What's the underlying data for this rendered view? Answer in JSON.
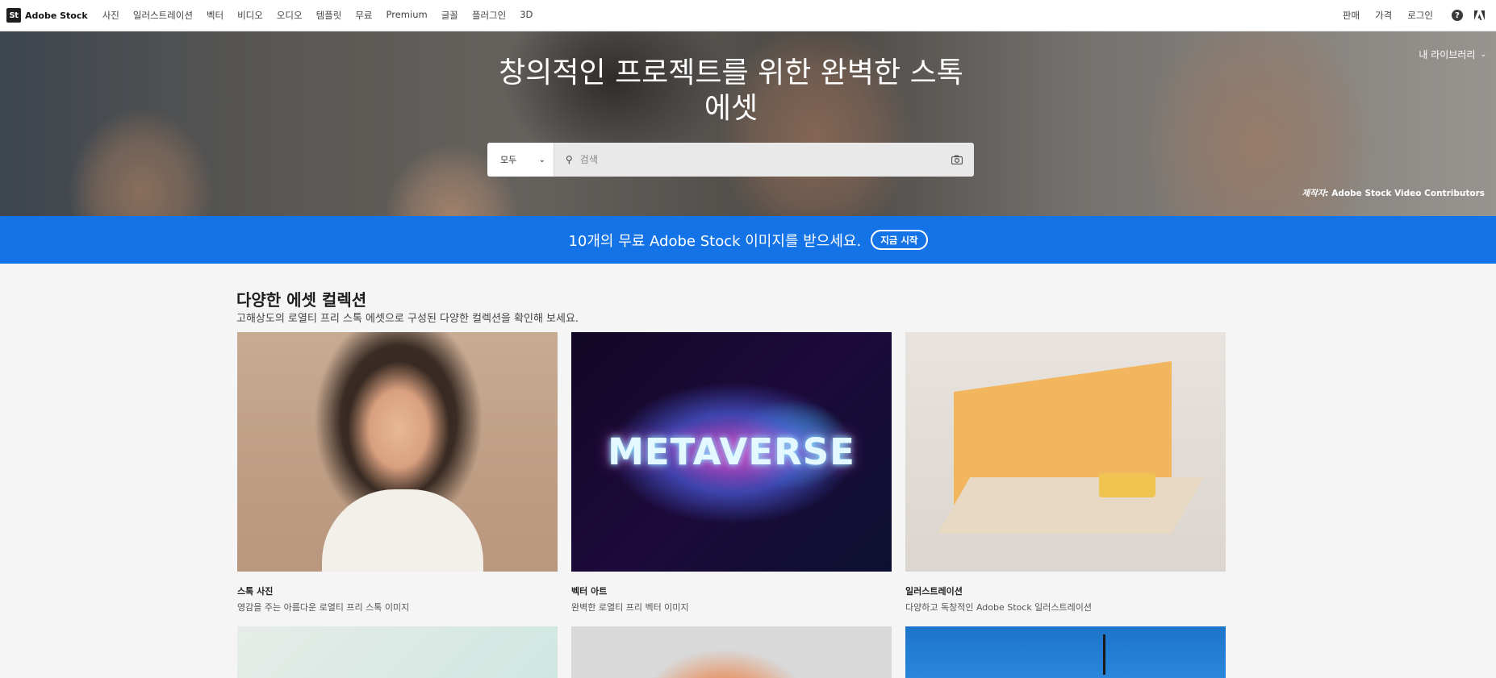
{
  "brand": {
    "logo": "St",
    "name": "Adobe Stock"
  },
  "nav": {
    "links": [
      "사진",
      "일러스트레이션",
      "벡터",
      "비디오",
      "오디오",
      "템플릿",
      "무료",
      "Premium",
      "글꼴",
      "플러그인",
      "3D"
    ],
    "right": [
      "판매",
      "가격",
      "로그인"
    ],
    "help_icon": "help-circle-icon",
    "adobe_icon": "adobe-logo-icon"
  },
  "hero": {
    "title": "창의적인 프로젝트를 위한 완벽한 스톡 에셋",
    "my_library": "내 라이브러리",
    "credit_prefix": "제작자:",
    "credit_name": "Adobe Stock Video Contributors",
    "search": {
      "filter": "모두",
      "placeholder": "검색"
    }
  },
  "promo": {
    "text": "10개의 무료 Adobe Stock 이미지를 받으세요.",
    "button": "지금 시작"
  },
  "collections": {
    "title": "다양한 에셋 컬렉션",
    "subtitle": "고해상도의 로열티 프리 스톡 에셋으로 구성된 다양한 컬렉션을 확인해 보세요.",
    "cards": [
      {
        "title": "스톡 사진",
        "desc": "영감을 주는 아름다운 로열티 프리 스톡 이미지"
      },
      {
        "title": "벡터 아트",
        "desc": "완벽한 로열티 프리 벡터 이미지",
        "image_text": "METAVERSE"
      },
      {
        "title": "일러스트레이션",
        "desc": "다양하고 독창적인 Adobe Stock 일러스트레이션"
      }
    ]
  },
  "colors": {
    "accent": "#1473e6"
  }
}
